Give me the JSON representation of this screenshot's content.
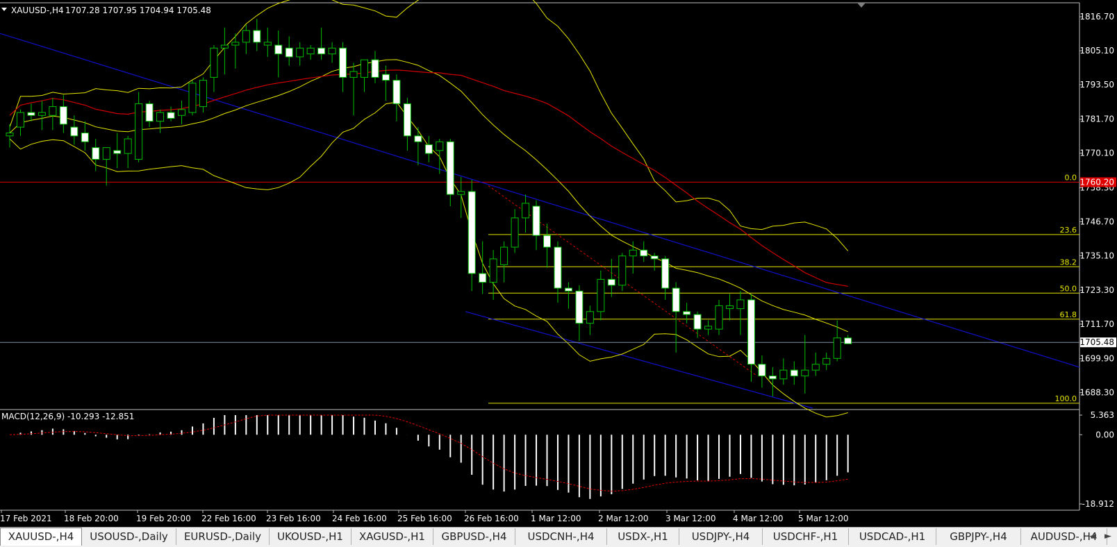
{
  "header": {
    "symbol_label": "XAUUSD-,H4",
    "ohlc": "1707.28 1707.95 1704.94 1705.48"
  },
  "chart_data": [
    {
      "type": "candlestick",
      "symbol": "XAUUSD-",
      "timeframe": "H4",
      "ylim": [
        1683,
        1821
      ],
      "y_ticks": [
        "1816.70",
        "1805.10",
        "1793.50",
        "1781.70",
        "1770.10",
        "1758.30",
        "1746.70",
        "1735.10",
        "1723.30",
        "1711.70",
        "1699.90",
        "1688.30"
      ],
      "x_tick_labels": [
        "17 Feb 2021",
        "18 Feb 20:00",
        "19 Feb 20:00",
        "22 Feb 16:00",
        "23 Feb 16:00",
        "24 Feb 16:00",
        "25 Feb 16:00",
        "26 Feb 16:00",
        "1 Mar 12:00",
        "2 Mar 12:00",
        "3 Mar 12:00",
        "4 Mar 12:00",
        "5 Mar 12:00"
      ],
      "candles": [
        {
          "o": 1776,
          "h": 1780,
          "l": 1772,
          "c": 1777
        },
        {
          "o": 1779,
          "h": 1785,
          "l": 1776,
          "c": 1784
        },
        {
          "o": 1784,
          "h": 1787,
          "l": 1781,
          "c": 1783
        },
        {
          "o": 1783,
          "h": 1788,
          "l": 1778,
          "c": 1784
        },
        {
          "o": 1783,
          "h": 1789,
          "l": 1778,
          "c": 1786
        },
        {
          "o": 1786,
          "h": 1790,
          "l": 1777,
          "c": 1780
        },
        {
          "o": 1779,
          "h": 1783,
          "l": 1773,
          "c": 1776
        },
        {
          "o": 1777,
          "h": 1781,
          "l": 1771,
          "c": 1774
        },
        {
          "o": 1772,
          "h": 1775,
          "l": 1764,
          "c": 1768
        },
        {
          "o": 1768,
          "h": 1772,
          "l": 1759,
          "c": 1772
        },
        {
          "o": 1771,
          "h": 1777,
          "l": 1765,
          "c": 1770
        },
        {
          "o": 1770,
          "h": 1776,
          "l": 1765,
          "c": 1775
        },
        {
          "o": 1768,
          "h": 1791,
          "l": 1767,
          "c": 1787
        },
        {
          "o": 1787,
          "h": 1788,
          "l": 1779,
          "c": 1781
        },
        {
          "o": 1781,
          "h": 1785,
          "l": 1777,
          "c": 1784
        },
        {
          "o": 1784,
          "h": 1786,
          "l": 1781,
          "c": 1782
        },
        {
          "o": 1783,
          "h": 1788,
          "l": 1780,
          "c": 1785
        },
        {
          "o": 1784,
          "h": 1795,
          "l": 1783,
          "c": 1794
        },
        {
          "o": 1786,
          "h": 1796,
          "l": 1784,
          "c": 1795
        },
        {
          "o": 1796,
          "h": 1807,
          "l": 1791,
          "c": 1806
        },
        {
          "o": 1806,
          "h": 1813,
          "l": 1797,
          "c": 1807
        },
        {
          "o": 1807,
          "h": 1811,
          "l": 1799,
          "c": 1808
        },
        {
          "o": 1808,
          "h": 1814,
          "l": 1804,
          "c": 1812
        },
        {
          "o": 1812,
          "h": 1816,
          "l": 1805,
          "c": 1808
        },
        {
          "o": 1807,
          "h": 1813,
          "l": 1803,
          "c": 1808
        },
        {
          "o": 1807,
          "h": 1812,
          "l": 1796,
          "c": 1804
        },
        {
          "o": 1806,
          "h": 1810,
          "l": 1800,
          "c": 1803
        },
        {
          "o": 1803,
          "h": 1808,
          "l": 1800,
          "c": 1806
        },
        {
          "o": 1804,
          "h": 1807,
          "l": 1802,
          "c": 1806
        },
        {
          "o": 1806,
          "h": 1813,
          "l": 1802,
          "c": 1804
        },
        {
          "o": 1804,
          "h": 1808,
          "l": 1801,
          "c": 1806
        },
        {
          "o": 1806,
          "h": 1808,
          "l": 1791,
          "c": 1796
        },
        {
          "o": 1796,
          "h": 1801,
          "l": 1783,
          "c": 1798
        },
        {
          "o": 1796,
          "h": 1802,
          "l": 1791,
          "c": 1802
        },
        {
          "o": 1802,
          "h": 1805,
          "l": 1794,
          "c": 1796
        },
        {
          "o": 1797,
          "h": 1800,
          "l": 1788,
          "c": 1795
        },
        {
          "o": 1795,
          "h": 1797,
          "l": 1781,
          "c": 1787
        },
        {
          "o": 1787,
          "h": 1789,
          "l": 1771,
          "c": 1776
        },
        {
          "o": 1776,
          "h": 1779,
          "l": 1766,
          "c": 1774
        },
        {
          "o": 1773,
          "h": 1776,
          "l": 1767,
          "c": 1770
        },
        {
          "o": 1771,
          "h": 1775,
          "l": 1763,
          "c": 1774
        },
        {
          "o": 1774,
          "h": 1775,
          "l": 1752,
          "c": 1756
        },
        {
          "o": 1756,
          "h": 1762,
          "l": 1748,
          "c": 1757
        },
        {
          "o": 1757,
          "h": 1761,
          "l": 1723,
          "c": 1729
        },
        {
          "o": 1729,
          "h": 1740,
          "l": 1722,
          "c": 1726
        },
        {
          "o": 1726,
          "h": 1737,
          "l": 1720,
          "c": 1734
        },
        {
          "o": 1732,
          "h": 1740,
          "l": 1726,
          "c": 1738
        },
        {
          "o": 1738,
          "h": 1751,
          "l": 1736,
          "c": 1748
        },
        {
          "o": 1748,
          "h": 1756,
          "l": 1743,
          "c": 1753
        },
        {
          "o": 1752,
          "h": 1754,
          "l": 1737,
          "c": 1742
        },
        {
          "o": 1742,
          "h": 1746,
          "l": 1731,
          "c": 1738
        },
        {
          "o": 1738,
          "h": 1740,
          "l": 1719,
          "c": 1724
        },
        {
          "o": 1724,
          "h": 1726,
          "l": 1717,
          "c": 1723
        },
        {
          "o": 1723,
          "h": 1725,
          "l": 1706,
          "c": 1712
        },
        {
          "o": 1712,
          "h": 1718,
          "l": 1708,
          "c": 1716
        },
        {
          "o": 1716,
          "h": 1730,
          "l": 1713,
          "c": 1727
        },
        {
          "o": 1727,
          "h": 1734,
          "l": 1721,
          "c": 1725
        },
        {
          "o": 1725,
          "h": 1736,
          "l": 1723,
          "c": 1735
        },
        {
          "o": 1735,
          "h": 1740,
          "l": 1729,
          "c": 1737
        },
        {
          "o": 1737,
          "h": 1740,
          "l": 1733,
          "c": 1735
        },
        {
          "o": 1735,
          "h": 1736,
          "l": 1730,
          "c": 1734
        },
        {
          "o": 1734,
          "h": 1735,
          "l": 1720,
          "c": 1724
        },
        {
          "o": 1724,
          "h": 1726,
          "l": 1702,
          "c": 1716
        },
        {
          "o": 1716,
          "h": 1719,
          "l": 1712,
          "c": 1715
        },
        {
          "o": 1715,
          "h": 1716,
          "l": 1707,
          "c": 1710
        },
        {
          "o": 1710,
          "h": 1713,
          "l": 1708,
          "c": 1711
        },
        {
          "o": 1710,
          "h": 1720,
          "l": 1708,
          "c": 1718
        },
        {
          "o": 1717,
          "h": 1722,
          "l": 1713,
          "c": 1718
        },
        {
          "o": 1717,
          "h": 1723,
          "l": 1708,
          "c": 1720
        },
        {
          "o": 1720,
          "h": 1722,
          "l": 1692,
          "c": 1698
        },
        {
          "o": 1698,
          "h": 1701,
          "l": 1690,
          "c": 1694
        },
        {
          "o": 1694,
          "h": 1697,
          "l": 1687,
          "c": 1693
        },
        {
          "o": 1693,
          "h": 1700,
          "l": 1691,
          "c": 1696
        },
        {
          "o": 1696,
          "h": 1699,
          "l": 1691,
          "c": 1694
        },
        {
          "o": 1694,
          "h": 1708,
          "l": 1688,
          "c": 1696
        },
        {
          "o": 1696,
          "h": 1702,
          "l": 1694,
          "c": 1698
        },
        {
          "o": 1698,
          "h": 1702,
          "l": 1696,
          "c": 1700
        },
        {
          "o": 1700,
          "h": 1713,
          "l": 1699,
          "c": 1707
        },
        {
          "o": 1707,
          "h": 1708,
          "l": 1705,
          "c": 1705
        }
      ],
      "current_price": "1705.48",
      "horizontal_line_price_label": "1760.20",
      "fibonacci_levels": [
        {
          "label": "0.0",
          "price": 1760.2
        },
        {
          "label": "23.6",
          "price": 1742.3
        },
        {
          "label": "38.2",
          "price": 1731.3
        },
        {
          "label": "50.0",
          "price": 1722.3
        },
        {
          "label": "61.8",
          "price": 1713.4
        },
        {
          "label": "100.0",
          "price": 1684.7
        }
      ],
      "colors": {
        "bull": "#000000",
        "bear": "#ffffff",
        "wick": "#00c000",
        "ma": "#d00000",
        "bands": "#e8e800",
        "channel": "#1010d0",
        "fib": "#e8e800",
        "price_line": "#8090a0",
        "hline": "#e00000"
      }
    },
    {
      "type": "macd",
      "label": "MACD(12,26,9) -10.293 -12.851",
      "ylim": [
        -18.912,
        5.363
      ],
      "y_ticks": [
        "5.363",
        "0.00",
        "-18.912"
      ],
      "histogram_color": "#ffffff",
      "signal_color": "#e00000"
    }
  ],
  "tabs": [
    "XAUUSD-,H4",
    "USOUSD-,Daily",
    "EURUSD-,Daily",
    "UKOUSD-,H1",
    "XAGUSD-,H1",
    "GBPUSD-,H4",
    "USDCNH-,H4",
    "USDX-,H1",
    "USDJPY-,H4",
    "USDCHF-,H1",
    "USDCAD-,H1",
    "GBPJPY-,H4",
    "AUDUSD-,H4"
  ],
  "tab_arrows": [
    "◄",
    "►"
  ]
}
